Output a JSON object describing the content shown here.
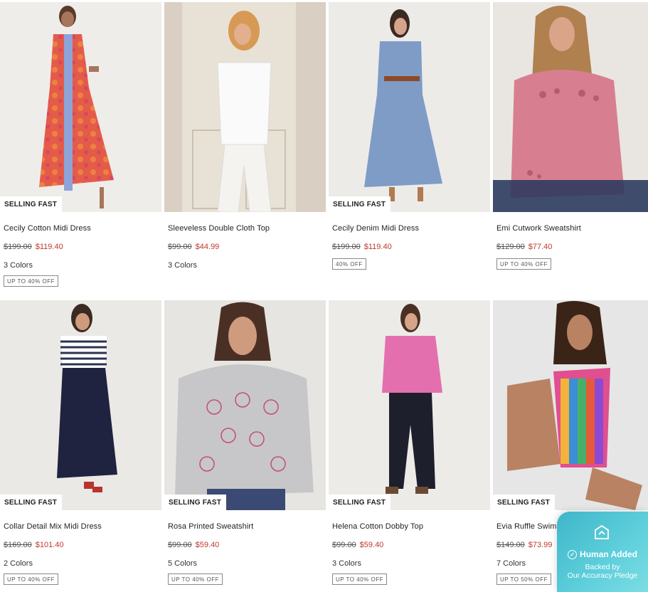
{
  "products": [
    {
      "name": "Cecily Cotton Midi Dress",
      "original": "$199.00",
      "sale": "$119.40",
      "colors": "3 Colors",
      "promo": "UP TO 40% OFF",
      "badge": "SELLING FAST"
    },
    {
      "name": "Sleeveless Double Cloth Top",
      "original": "$99.00",
      "sale": "$44.99",
      "colors": "3 Colors",
      "promo": "",
      "badge": ""
    },
    {
      "name": "Cecily Denim Midi Dress",
      "original": "$199.00",
      "sale": "$119.40",
      "colors": "",
      "promo": "40% OFF",
      "badge": "SELLING FAST"
    },
    {
      "name": "Emi Cutwork Sweatshirt",
      "original": "$129.00",
      "sale": "$77.40",
      "colors": "",
      "promo": "UP TO 40% OFF",
      "badge": ""
    },
    {
      "name": "Collar Detail Mix Midi Dress",
      "original": "$169.00",
      "sale": "$101.40",
      "colors": "2 Colors",
      "promo": "UP TO 40% OFF",
      "badge": "SELLING FAST"
    },
    {
      "name": "Rosa Printed Sweatshirt",
      "original": "$99.00",
      "sale": "$59.40",
      "colors": "5 Colors",
      "promo": "UP TO 40% OFF",
      "badge": "SELLING FAST"
    },
    {
      "name": "Helena Cotton Dobby Top",
      "original": "$99.00",
      "sale": "$59.40",
      "colors": "3 Colors",
      "promo": "UP TO 40% OFF",
      "badge": "SELLING FAST"
    },
    {
      "name": "Evia Ruffle Swimsuit",
      "original": "$149.00",
      "sale": "$73.99",
      "colors": "7 Colors",
      "promo": "UP TO 50% OFF",
      "badge": "SELLING FAST"
    }
  ],
  "pledge": {
    "status": "Human Added",
    "line1": "Backed by",
    "line2": "Our Accuracy Pledge"
  },
  "colors": {
    "sale": "#c0392b",
    "pledge": "#4cc3d3"
  }
}
